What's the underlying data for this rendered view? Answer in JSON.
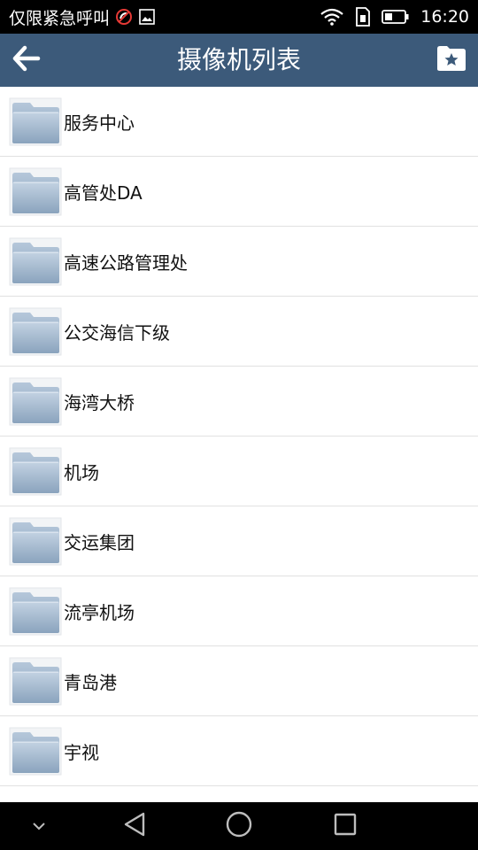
{
  "status_bar": {
    "carrier_text": "仅限紧急呼叫",
    "time": "16:20",
    "icons": [
      "no-call-icon",
      "image-icon",
      "wifi-icon",
      "sim-icon",
      "battery-icon"
    ]
  },
  "app_bar": {
    "title": "摄像机列表",
    "back_icon": "arrow-left-icon",
    "favorite_icon": "folder-star-icon",
    "background_color": "#3c5a7a"
  },
  "list": {
    "items": [
      {
        "label": "服务中心"
      },
      {
        "label": "高管处DA"
      },
      {
        "label": "高速公路管理处"
      },
      {
        "label": "公交海信下级"
      },
      {
        "label": "海湾大桥"
      },
      {
        "label": "机场"
      },
      {
        "label": "交运集团"
      },
      {
        "label": "流亭机场"
      },
      {
        "label": "青岛港"
      },
      {
        "label": "宇视"
      }
    ],
    "item_icon": "folder-icon"
  },
  "nav_bar": {
    "buttons": [
      "collapse-icon",
      "back-triangle-icon",
      "home-circle-icon",
      "recent-square-icon"
    ]
  }
}
